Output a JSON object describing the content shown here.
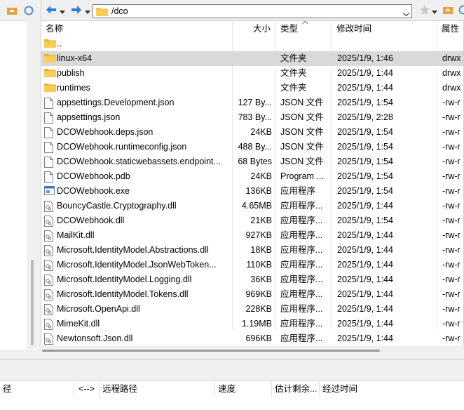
{
  "local": {},
  "remote": {
    "path": "/dco",
    "columns": {
      "name": "名称",
      "size": "大小",
      "type": "类型",
      "modified": "修改时间",
      "attrs": "属性"
    },
    "files": [
      {
        "name": "..",
        "size": "",
        "type": "",
        "modified": "",
        "attrs": "",
        "icon": "folder-icon"
      },
      {
        "name": "linux-x64",
        "size": "",
        "type": "文件夹",
        "modified": "2025/1/9, 1:46",
        "attrs": "drwx",
        "icon": "folder-icon",
        "selected": true
      },
      {
        "name": "publish",
        "size": "",
        "type": "文件夹",
        "modified": "2025/1/9, 1:44",
        "attrs": "drwx",
        "icon": "folder-icon"
      },
      {
        "name": "runtimes",
        "size": "",
        "type": "文件夹",
        "modified": "2025/1/9, 1:44",
        "attrs": "drwx",
        "icon": "folder-icon"
      },
      {
        "name": "appsettings.Development.json",
        "size": "127 By...",
        "type": "JSON 文件",
        "modified": "2025/1/9, 1:54",
        "attrs": "-rw-r",
        "icon": "file-icon"
      },
      {
        "name": "appsettings.json",
        "size": "783 By...",
        "type": "JSON 文件",
        "modified": "2025/1/9, 2:28",
        "attrs": "-rw-r",
        "icon": "file-icon"
      },
      {
        "name": "DCOWebhook.deps.json",
        "size": "24KB",
        "type": "JSON 文件",
        "modified": "2025/1/9, 1:54",
        "attrs": "-rw-r",
        "icon": "file-icon"
      },
      {
        "name": "DCOWebhook.runtimeconfig.json",
        "size": "488 By...",
        "type": "JSON 文件",
        "modified": "2025/1/9, 1:54",
        "attrs": "-rw-r",
        "icon": "file-icon"
      },
      {
        "name": "DCOWebhook.staticwebassets.endpoint...",
        "size": "68 Bytes",
        "type": "JSON 文件",
        "modified": "2025/1/9, 1:54",
        "attrs": "-rw-r",
        "icon": "file-icon"
      },
      {
        "name": "DCOWebhook.pdb",
        "size": "24KB",
        "type": "Program ...",
        "modified": "2025/1/9, 1:54",
        "attrs": "-rw-r",
        "icon": "file-icon"
      },
      {
        "name": "DCOWebhook.exe",
        "size": "136KB",
        "type": "应用程序",
        "modified": "2025/1/9, 1:54",
        "attrs": "-rw-r",
        "icon": "exe-icon"
      },
      {
        "name": "BouncyCastle.Cryptography.dll",
        "size": "4.65MB",
        "type": "应用程序...",
        "modified": "2025/1/9, 1:44",
        "attrs": "-rw-r",
        "icon": "dll-icon"
      },
      {
        "name": "DCOWebhook.dll",
        "size": "21KB",
        "type": "应用程序...",
        "modified": "2025/1/9, 1:54",
        "attrs": "-rw-r",
        "icon": "dll-icon"
      },
      {
        "name": "MailKit.dll",
        "size": "927KB",
        "type": "应用程序...",
        "modified": "2025/1/9, 1:44",
        "attrs": "-rw-r",
        "icon": "dll-icon"
      },
      {
        "name": "Microsoft.IdentityModel.Abstractions.dll",
        "size": "18KB",
        "type": "应用程序...",
        "modified": "2025/1/9, 1:44",
        "attrs": "-rw-r",
        "icon": "dll-icon"
      },
      {
        "name": "Microsoft.IdentityModel.JsonWebToken...",
        "size": "110KB",
        "type": "应用程序...",
        "modified": "2025/1/9, 1:44",
        "attrs": "-rw-r",
        "icon": "dll-icon"
      },
      {
        "name": "Microsoft.IdentityModel.Logging.dll",
        "size": "36KB",
        "type": "应用程序...",
        "modified": "2025/1/9, 1:44",
        "attrs": "-rw-r",
        "icon": "dll-icon"
      },
      {
        "name": "Microsoft.IdentityModel.Tokens.dll",
        "size": "969KB",
        "type": "应用程序...",
        "modified": "2025/1/9, 1:44",
        "attrs": "-rw-r",
        "icon": "dll-icon"
      },
      {
        "name": "Microsoft.OpenApi.dll",
        "size": "228KB",
        "type": "应用程序...",
        "modified": "2025/1/9, 1:44",
        "attrs": "-rw-r",
        "icon": "dll-icon"
      },
      {
        "name": "MimeKit.dll",
        "size": "1.19MB",
        "type": "应用程序...",
        "modified": "2025/1/9, 1:44",
        "attrs": "-rw-r",
        "icon": "dll-icon"
      },
      {
        "name": "Newtonsoft.Json.dll",
        "size": "696KB",
        "type": "应用程序...",
        "modified": "2025/1/9, 1:44",
        "attrs": "-rw-r",
        "icon": "dll-icon"
      }
    ]
  },
  "queue": {
    "columns": {
      "local_path": "径",
      "direction": "<-->",
      "remote_path": "远程路径",
      "speed": "速度",
      "eta": "估计剩余...",
      "elapsed": "经过时间"
    }
  },
  "colors": {
    "folder": "#f5c242",
    "selection": "#d9d9d9",
    "nav_blue": "#2b7fd7"
  }
}
